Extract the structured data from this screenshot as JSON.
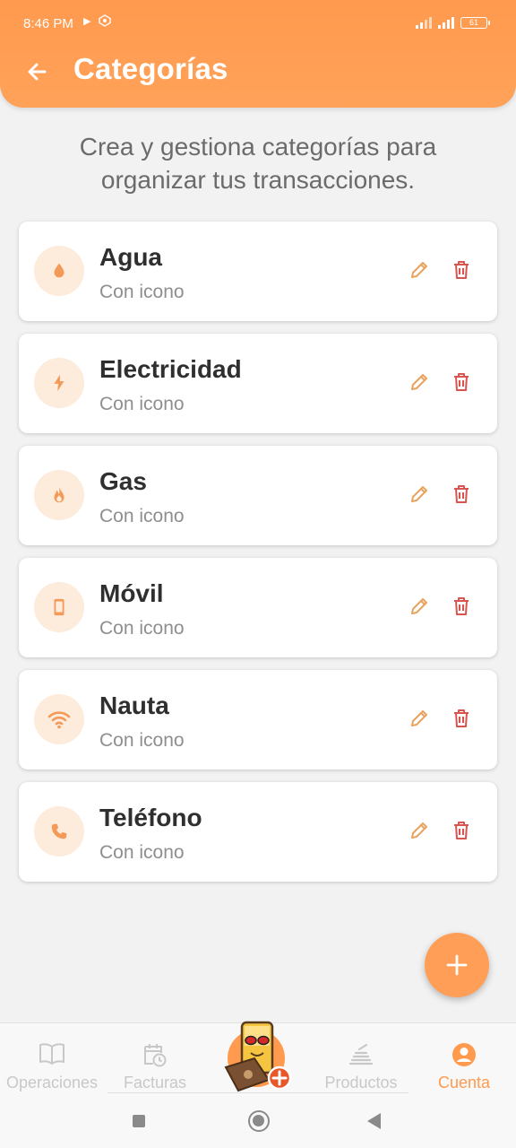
{
  "status_bar": {
    "time": "8:46 PM",
    "battery": "61"
  },
  "header": {
    "title": "Categorías",
    "back_icon": "arrow-left-icon"
  },
  "subtitle": "Crea y gestiona categorías para organizar tus transacciones.",
  "categories": [
    {
      "name": "Agua",
      "subtitle": "Con icono",
      "icon": "water-drop-icon"
    },
    {
      "name": "Electricidad",
      "subtitle": "Con icono",
      "icon": "bolt-icon"
    },
    {
      "name": "Gas",
      "subtitle": "Con icono",
      "icon": "flame-icon"
    },
    {
      "name": "Móvil",
      "subtitle": "Con icono",
      "icon": "smartphone-icon"
    },
    {
      "name": "Nauta",
      "subtitle": "Con icono",
      "icon": "wifi-icon"
    },
    {
      "name": "Teléfono",
      "subtitle": "Con icono",
      "icon": "phone-icon"
    }
  ],
  "bottom_nav": {
    "items": [
      {
        "label": "Operaciones",
        "icon": "book-icon"
      },
      {
        "label": "Facturas",
        "icon": "calendar-clock-icon"
      },
      {
        "label": "Productos",
        "icon": "food-tray-icon"
      },
      {
        "label": "Cuenta",
        "icon": "account-circle-icon"
      }
    ],
    "active": "Cuenta"
  },
  "colors": {
    "accent": "#ff9a4e",
    "icon_bg": "#fdebdc",
    "icon_fg": "#f39a58",
    "edit": "#e9a35f",
    "delete": "#d9534f"
  }
}
